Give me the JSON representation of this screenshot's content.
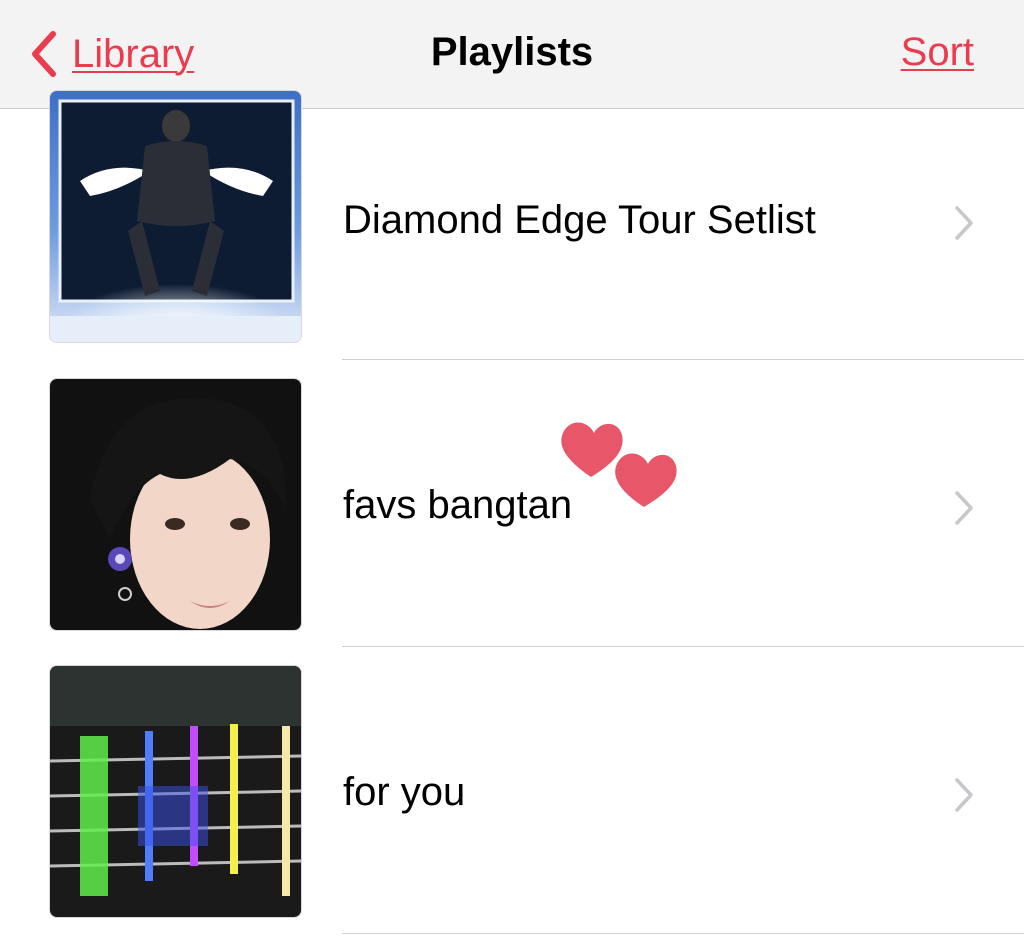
{
  "navbar": {
    "back_label": "Library",
    "title": "Playlists",
    "sort_label": "Sort"
  },
  "playlists": [
    {
      "title": "Diamond Edge Tour Setlist",
      "artwork": "performer-with-wings-stage-photo"
    },
    {
      "title": "favs bangtan",
      "artwork": "portrait-photo-dark-hair"
    },
    {
      "title": "for you",
      "artwork": "neon-light-bars-photo"
    }
  ],
  "colors": {
    "accent": "#e93c4f",
    "navbar_bg": "#f3f3f4",
    "chevron": "#c7c7cc",
    "heart": "#e8566a"
  },
  "icons": {
    "back": "chevron-left-icon",
    "row_disclosure": "chevron-right-icon",
    "sticker": "hearts-sticker"
  }
}
